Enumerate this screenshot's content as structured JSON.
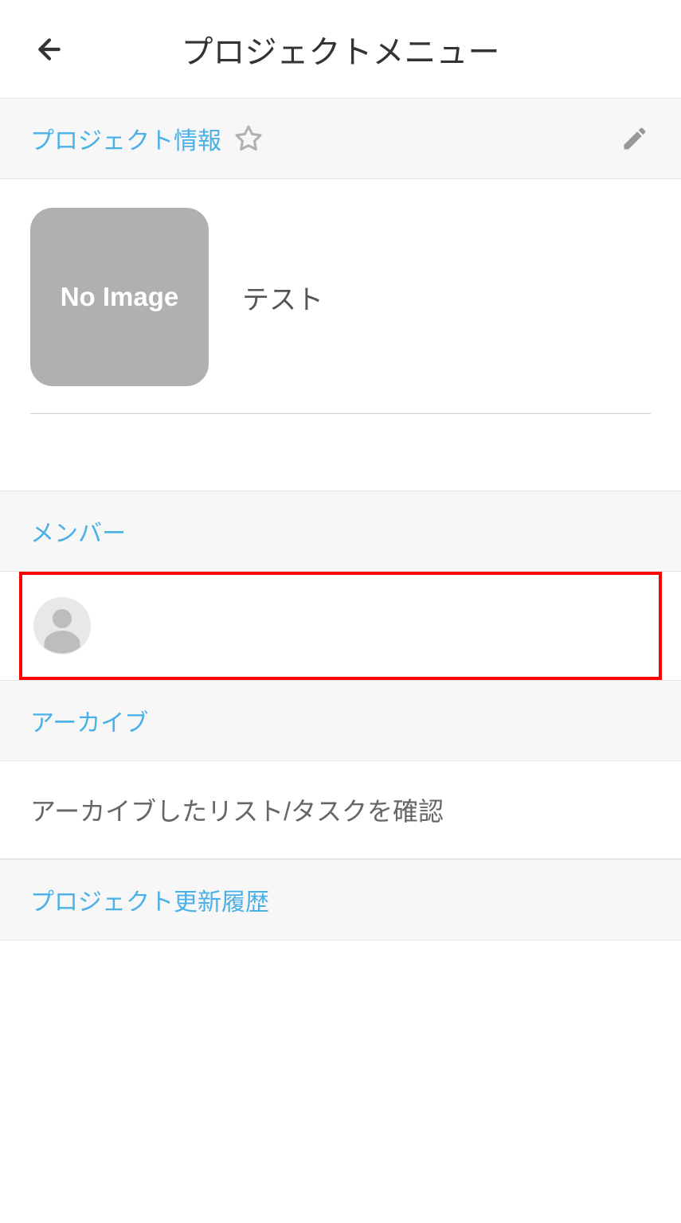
{
  "header": {
    "title": "プロジェクトメニュー"
  },
  "projectInfo": {
    "sectionTitle": "プロジェクト情報",
    "imagePlaceholder": "No Image",
    "projectName": "テスト"
  },
  "members": {
    "sectionTitle": "メンバー"
  },
  "archive": {
    "sectionTitle": "アーカイブ",
    "description": "アーカイブしたリスト/タスクを確認"
  },
  "history": {
    "sectionTitle": "プロジェクト更新履歴"
  }
}
